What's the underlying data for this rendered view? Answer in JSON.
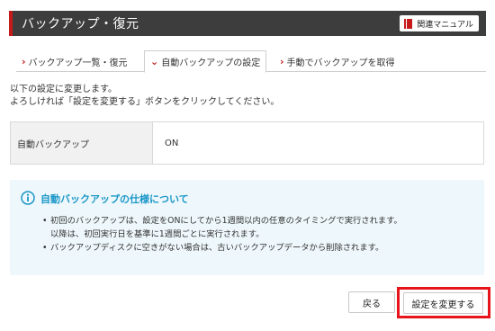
{
  "header": {
    "title": "バックアップ・復元",
    "manual_label": "関連マニュアル"
  },
  "tabs": [
    {
      "label": "バックアップ一覧・復元",
      "icon": "chevron-right-icon",
      "active": false
    },
    {
      "label": "自動バックアップの設定",
      "icon": "chevron-down-icon",
      "active": true
    },
    {
      "label": "手動でバックアップを取得",
      "icon": "chevron-right-icon",
      "active": false
    }
  ],
  "intro": {
    "line1": "以下の設定に変更します。",
    "line2": "よろしければ「設定を変更する」ボタンをクリックしてください。"
  },
  "settings": {
    "label": "自動バックアップ",
    "value": "ON"
  },
  "info": {
    "title": "自動バックアップの仕様について",
    "item1_line1": "初回のバックアップは、設定をONにしてから1週間以内の任意のタイミングで実行されます。",
    "item1_line2": "以降は、初回実行日を基準に1週間ごとに実行されます。",
    "item2": "バックアップディスクに空きがない場合は、古いバックアップデータから削除されます。"
  },
  "buttons": {
    "back_label": "戻る",
    "apply_label": "設定を変更する"
  },
  "colors": {
    "accent_red": "#c41a1a",
    "header_bg": "#3d3d3d",
    "info_blue": "#1a97c7",
    "info_bg": "#eef7fb",
    "highlight_red": "#e8141b"
  }
}
